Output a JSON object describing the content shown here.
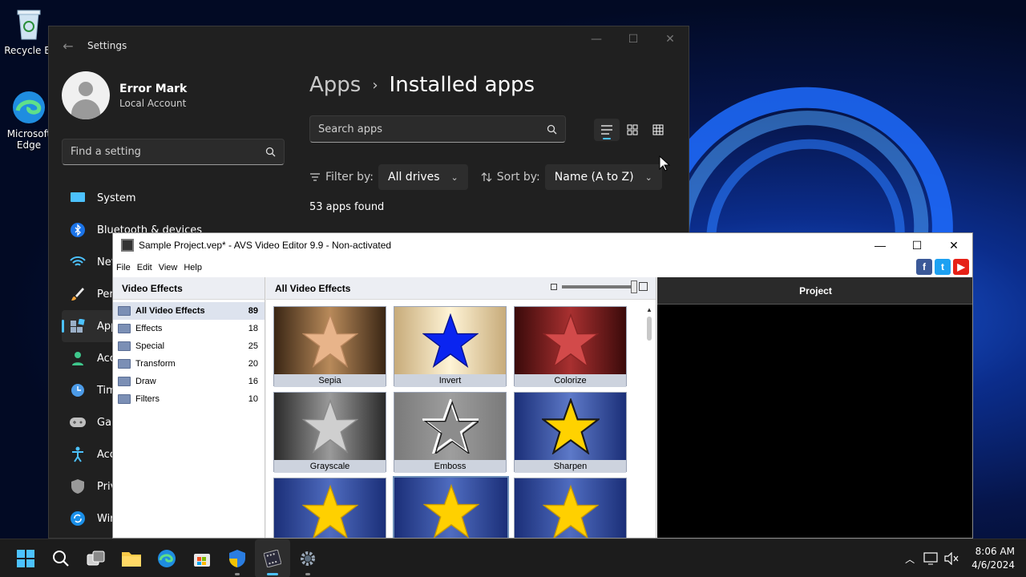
{
  "desktop": {
    "icons": [
      {
        "label": "Recycle Bi"
      },
      {
        "label": "Microsoft Edge"
      }
    ]
  },
  "settings": {
    "window_title": "Settings",
    "user": {
      "name": "Error Mark",
      "account_type": "Local Account"
    },
    "find_placeholder": "Find a setting",
    "nav": [
      {
        "label": "System",
        "icon": "monitor-icon"
      },
      {
        "label": "Bluetooth & devices",
        "icon": "bluetooth-icon"
      },
      {
        "label": "Net",
        "icon": "wifi-icon"
      },
      {
        "label": "Pers",
        "icon": "brush-icon"
      },
      {
        "label": "App",
        "icon": "apps-icon"
      },
      {
        "label": "Acc",
        "icon": "person-icon"
      },
      {
        "label": "Tim",
        "icon": "clock-icon"
      },
      {
        "label": "Gar",
        "icon": "gamepad-icon"
      },
      {
        "label": "Acc",
        "icon": "accessibility-icon"
      },
      {
        "label": "Priv",
        "icon": "shield-icon"
      },
      {
        "label": "Win",
        "icon": "update-icon"
      }
    ],
    "breadcrumb": {
      "parent": "Apps",
      "separator": "›",
      "current": "Installed apps"
    },
    "search_placeholder": "Search apps",
    "filter_label": "Filter by:",
    "filter_value": "All drives",
    "sort_label": "Sort by:",
    "sort_value": "Name (A to Z)",
    "apps_found": "53 apps found"
  },
  "avs": {
    "window_title": "Sample Project.vep* - AVS Video Editor 9.9 - Non-activated",
    "menu": [
      "File",
      "Edit",
      "View",
      "Help"
    ],
    "left_header": "Video Effects",
    "categories": [
      {
        "name": "All Video Effects",
        "count": "89"
      },
      {
        "name": "Effects",
        "count": "18"
      },
      {
        "name": "Special",
        "count": "25"
      },
      {
        "name": "Transform",
        "count": "20"
      },
      {
        "name": "Draw",
        "count": "16"
      },
      {
        "name": "Filters",
        "count": "10"
      }
    ],
    "middle_header": "All Video Effects",
    "effects": [
      {
        "label": "Sepia"
      },
      {
        "label": "Invert"
      },
      {
        "label": "Colorize"
      },
      {
        "label": "Grayscale"
      },
      {
        "label": "Emboss"
      },
      {
        "label": "Sharpen"
      },
      {
        "label": ""
      },
      {
        "label": ""
      },
      {
        "label": ""
      }
    ],
    "right_header": "Project"
  },
  "taskbar": {
    "time": "8:06 AM",
    "date": "4/6/2024"
  },
  "colors": {
    "accent": "#4cc2ff",
    "settings_bg": "#202020",
    "avs_bg": "#f0f0f0"
  }
}
